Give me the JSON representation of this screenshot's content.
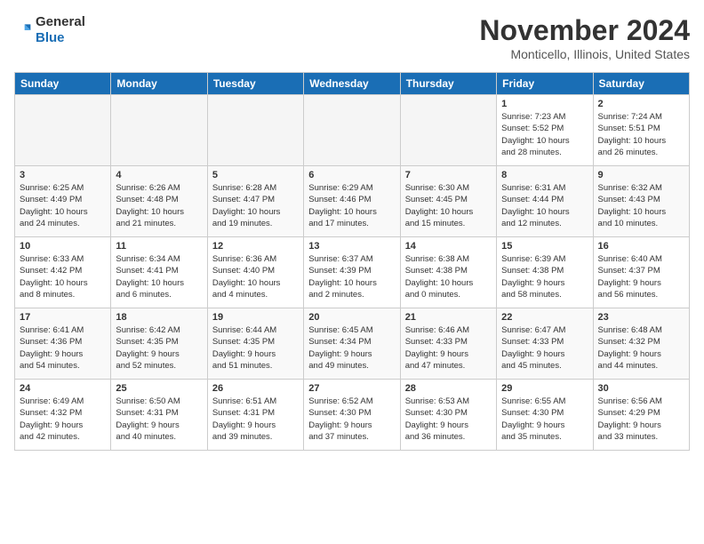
{
  "header": {
    "logo_line1": "General",
    "logo_line2": "Blue",
    "month_year": "November 2024",
    "location": "Monticello, Illinois, United States"
  },
  "weekdays": [
    "Sunday",
    "Monday",
    "Tuesday",
    "Wednesday",
    "Thursday",
    "Friday",
    "Saturday"
  ],
  "weeks": [
    [
      {
        "day": "",
        "info": ""
      },
      {
        "day": "",
        "info": ""
      },
      {
        "day": "",
        "info": ""
      },
      {
        "day": "",
        "info": ""
      },
      {
        "day": "",
        "info": ""
      },
      {
        "day": "1",
        "info": "Sunrise: 7:23 AM\nSunset: 5:52 PM\nDaylight: 10 hours\nand 28 minutes."
      },
      {
        "day": "2",
        "info": "Sunrise: 7:24 AM\nSunset: 5:51 PM\nDaylight: 10 hours\nand 26 minutes."
      }
    ],
    [
      {
        "day": "3",
        "info": "Sunrise: 6:25 AM\nSunset: 4:49 PM\nDaylight: 10 hours\nand 24 minutes."
      },
      {
        "day": "4",
        "info": "Sunrise: 6:26 AM\nSunset: 4:48 PM\nDaylight: 10 hours\nand 21 minutes."
      },
      {
        "day": "5",
        "info": "Sunrise: 6:28 AM\nSunset: 4:47 PM\nDaylight: 10 hours\nand 19 minutes."
      },
      {
        "day": "6",
        "info": "Sunrise: 6:29 AM\nSunset: 4:46 PM\nDaylight: 10 hours\nand 17 minutes."
      },
      {
        "day": "7",
        "info": "Sunrise: 6:30 AM\nSunset: 4:45 PM\nDaylight: 10 hours\nand 15 minutes."
      },
      {
        "day": "8",
        "info": "Sunrise: 6:31 AM\nSunset: 4:44 PM\nDaylight: 10 hours\nand 12 minutes."
      },
      {
        "day": "9",
        "info": "Sunrise: 6:32 AM\nSunset: 4:43 PM\nDaylight: 10 hours\nand 10 minutes."
      }
    ],
    [
      {
        "day": "10",
        "info": "Sunrise: 6:33 AM\nSunset: 4:42 PM\nDaylight: 10 hours\nand 8 minutes."
      },
      {
        "day": "11",
        "info": "Sunrise: 6:34 AM\nSunset: 4:41 PM\nDaylight: 10 hours\nand 6 minutes."
      },
      {
        "day": "12",
        "info": "Sunrise: 6:36 AM\nSunset: 4:40 PM\nDaylight: 10 hours\nand 4 minutes."
      },
      {
        "day": "13",
        "info": "Sunrise: 6:37 AM\nSunset: 4:39 PM\nDaylight: 10 hours\nand 2 minutes."
      },
      {
        "day": "14",
        "info": "Sunrise: 6:38 AM\nSunset: 4:38 PM\nDaylight: 10 hours\nand 0 minutes."
      },
      {
        "day": "15",
        "info": "Sunrise: 6:39 AM\nSunset: 4:38 PM\nDaylight: 9 hours\nand 58 minutes."
      },
      {
        "day": "16",
        "info": "Sunrise: 6:40 AM\nSunset: 4:37 PM\nDaylight: 9 hours\nand 56 minutes."
      }
    ],
    [
      {
        "day": "17",
        "info": "Sunrise: 6:41 AM\nSunset: 4:36 PM\nDaylight: 9 hours\nand 54 minutes."
      },
      {
        "day": "18",
        "info": "Sunrise: 6:42 AM\nSunset: 4:35 PM\nDaylight: 9 hours\nand 52 minutes."
      },
      {
        "day": "19",
        "info": "Sunrise: 6:44 AM\nSunset: 4:35 PM\nDaylight: 9 hours\nand 51 minutes."
      },
      {
        "day": "20",
        "info": "Sunrise: 6:45 AM\nSunset: 4:34 PM\nDaylight: 9 hours\nand 49 minutes."
      },
      {
        "day": "21",
        "info": "Sunrise: 6:46 AM\nSunset: 4:33 PM\nDaylight: 9 hours\nand 47 minutes."
      },
      {
        "day": "22",
        "info": "Sunrise: 6:47 AM\nSunset: 4:33 PM\nDaylight: 9 hours\nand 45 minutes."
      },
      {
        "day": "23",
        "info": "Sunrise: 6:48 AM\nSunset: 4:32 PM\nDaylight: 9 hours\nand 44 minutes."
      }
    ],
    [
      {
        "day": "24",
        "info": "Sunrise: 6:49 AM\nSunset: 4:32 PM\nDaylight: 9 hours\nand 42 minutes."
      },
      {
        "day": "25",
        "info": "Sunrise: 6:50 AM\nSunset: 4:31 PM\nDaylight: 9 hours\nand 40 minutes."
      },
      {
        "day": "26",
        "info": "Sunrise: 6:51 AM\nSunset: 4:31 PM\nDaylight: 9 hours\nand 39 minutes."
      },
      {
        "day": "27",
        "info": "Sunrise: 6:52 AM\nSunset: 4:30 PM\nDaylight: 9 hours\nand 37 minutes."
      },
      {
        "day": "28",
        "info": "Sunrise: 6:53 AM\nSunset: 4:30 PM\nDaylight: 9 hours\nand 36 minutes."
      },
      {
        "day": "29",
        "info": "Sunrise: 6:55 AM\nSunset: 4:30 PM\nDaylight: 9 hours\nand 35 minutes."
      },
      {
        "day": "30",
        "info": "Sunrise: 6:56 AM\nSunset: 4:29 PM\nDaylight: 9 hours\nand 33 minutes."
      }
    ]
  ]
}
